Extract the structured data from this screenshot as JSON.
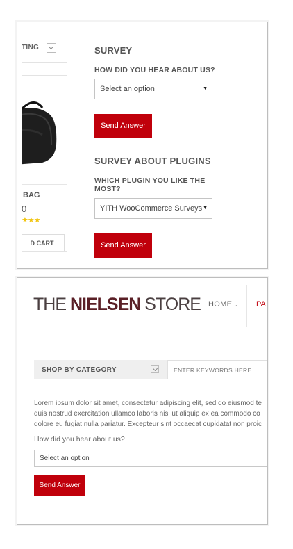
{
  "top_panel": {
    "sort_label": "TING",
    "product": {
      "name": "BAG",
      "price": "0",
      "stars": "★★★",
      "add_to_cart": "D CART"
    },
    "survey_widget": {
      "title": "SURVEY",
      "question": "HOW DID YOU HEAR ABOUT US?",
      "select_value": "Select an option",
      "button_label": "Send Answer"
    },
    "plugins_widget": {
      "title": "SURVEY ABOUT PLUGINS",
      "question": "WHICH PLUGIN YOU LIKE THE MOST?",
      "select_value": "YITH WooCommerce Surveys",
      "button_label": "Send Answer"
    }
  },
  "bottom_panel": {
    "logo": {
      "part1": "THE ",
      "part2": "NIELSEN",
      "part3": " STORE"
    },
    "nav": {
      "home": "HOME",
      "next": "PA"
    },
    "category_bar": {
      "label": "SHOP BY CATEGORY"
    },
    "search": {
      "placeholder": "ENTER KEYWORDS HERE ..."
    },
    "lorem_lines": [
      "Lorem ipsum dolor sit amet, consectetur adipiscing elit, sed do eiusmod te",
      "quis nostrud exercitation ullamco laboris nisi ut aliquip ex ea commodo co",
      "dolore eu fugiat nulla pariatur. Excepteur sint occaecat cupidatat non proic"
    ],
    "form": {
      "question": "How did you hear about us?",
      "select_value": "Select an option",
      "button_label": "Send Answer"
    }
  },
  "colors": {
    "accent": "#c0000b",
    "logo_bold": "#5a1f26",
    "rating": "#f1c40f"
  }
}
